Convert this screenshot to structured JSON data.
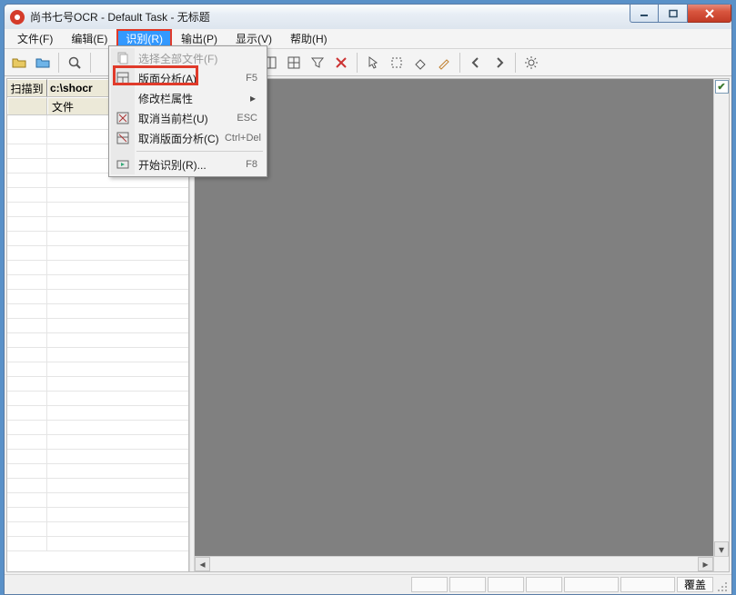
{
  "window": {
    "title": "尚书七号OCR - Default Task - 无标题"
  },
  "menu": {
    "items": [
      "文件(F)",
      "编辑(E)",
      "识别(R)",
      "输出(P)",
      "显示(V)",
      "帮助(H)"
    ],
    "active_index": 2
  },
  "dropdown": {
    "items": [
      {
        "icon": "files",
        "label": "选择全部文件(F)",
        "shortcut": "",
        "disabled": true
      },
      {
        "icon": "layout",
        "label": "版面分析(A)",
        "shortcut": "F5",
        "disabled": false,
        "highlight": true
      },
      {
        "icon": "",
        "label": "修改栏属性",
        "shortcut": "",
        "disabled": false,
        "submenu": true
      },
      {
        "icon": "cancel",
        "label": "取消当前栏(U)",
        "shortcut": "ESC",
        "disabled": false
      },
      {
        "icon": "cancelall",
        "label": "取消版面分析(C)",
        "shortcut": "Ctrl+Del",
        "disabled": false
      },
      {
        "sep": true
      },
      {
        "icon": "run",
        "label": "开始识别(R)...",
        "shortcut": "F8",
        "disabled": false
      }
    ]
  },
  "left_pane": {
    "path_label": "扫描到",
    "path_value": "c:\\shocr",
    "columns": [
      "文件"
    ]
  },
  "statusbar": {
    "overwrite_label": "覆盖"
  }
}
